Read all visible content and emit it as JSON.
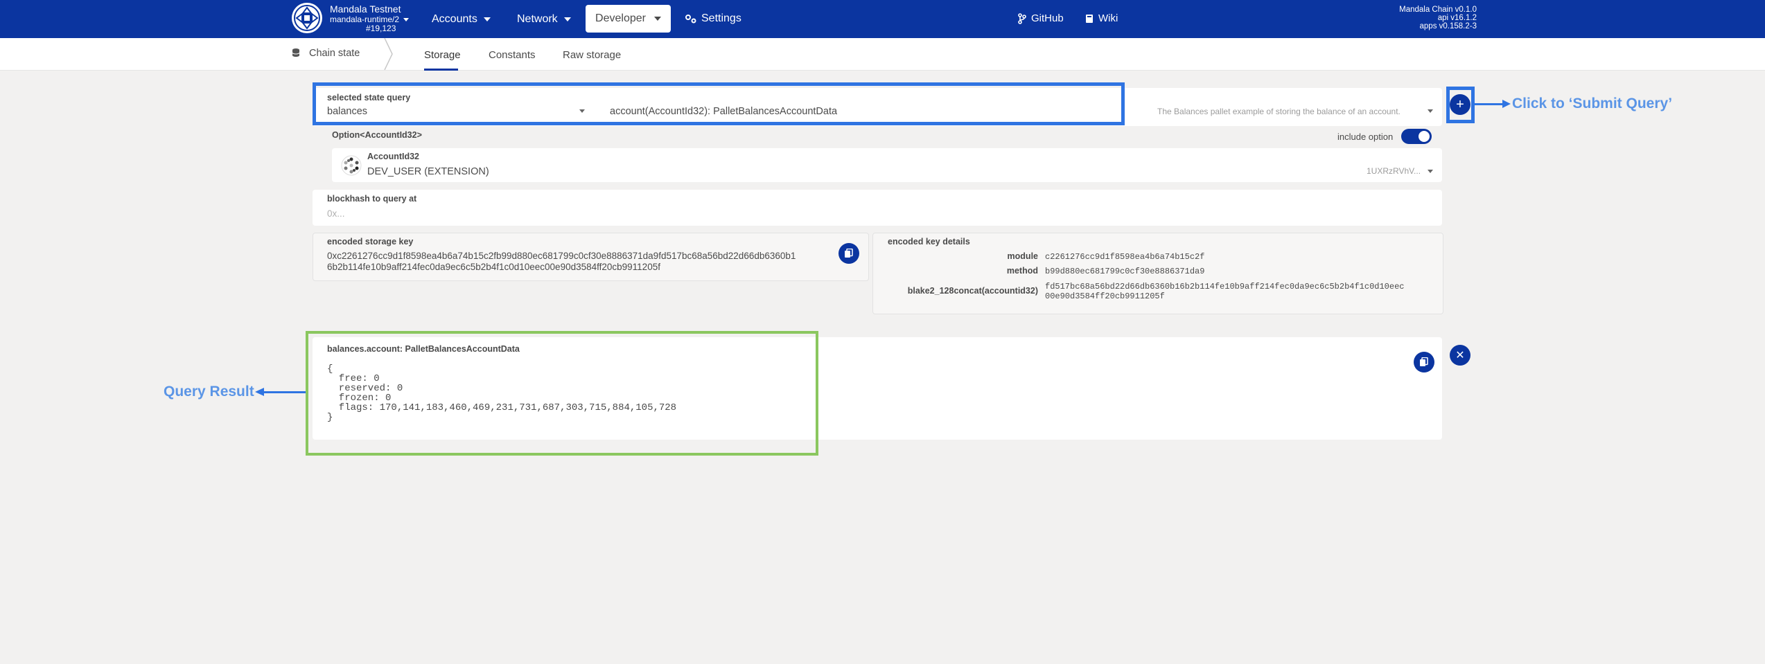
{
  "header": {
    "chain_name": "Mandala Testnet",
    "runtime": "mandala-runtime/2",
    "block": "#19,123",
    "nav": [
      "Accounts",
      "Network",
      "Developer",
      "Settings"
    ],
    "links": [
      "GitHub",
      "Wiki"
    ],
    "versions": [
      "Mandala Chain v0.1.0",
      "api v16.1.2",
      "apps v0.158.2-3"
    ]
  },
  "subnav": {
    "section": "Chain state",
    "tabs": [
      "Storage",
      "Constants",
      "Raw storage"
    ]
  },
  "query": {
    "label": "selected state query",
    "pallet": "balances",
    "method": "account(AccountId32): PalletBalancesAccountData",
    "description": "The Balances pallet example of storing the balance of an account."
  },
  "param": {
    "type_label": "Option<AccountId32>",
    "include_option": "include option",
    "account_label": "AccountId32",
    "account_name": "DEV_USER (EXTENSION)",
    "account_short": "1UXRzRVhV..."
  },
  "blockhash": {
    "label": "blockhash to query at",
    "placeholder": "0x..."
  },
  "storage_key": {
    "label": "encoded storage key",
    "line1": "0xc2261276cc9d1f8598ea4b6a74b15c2fb99d880ec681799c0cf30e8886371da9fd517bc68a56bd22d66db6360b1",
    "line2": "6b2b114fe10b9aff214fec0da9ec6c5b2b4f1c0d10eec00e90d3584ff20cb9911205f"
  },
  "key_details": {
    "label": "encoded key details",
    "rows": [
      {
        "key": "module",
        "value": "c2261276cc9d1f8598ea4b6a74b15c2f"
      },
      {
        "key": "method",
        "value": "b99d880ec681799c0cf30e8886371da9"
      },
      {
        "key": "blake2_128concat(accountid32)",
        "value": "fd517bc68a56bd22d66db6360b16b2b114fe10b9aff214fec0da9ec6c5b2b4f1c0d10eec",
        "value2": "00e90d3584ff20cb9911205f"
      }
    ]
  },
  "result": {
    "label": "balances.account: PalletBalancesAccountData",
    "body": "{\n  free: 0\n  reserved: 0\n  frozen: 0\n  flags: 170,141,183,460,469,231,731,687,303,715,884,105,728\n}"
  },
  "annotations": {
    "submit": "Click to ‘Submit Query’",
    "result": "Query Result"
  },
  "colors": {
    "brand": "#0b35a0",
    "highlight_blue": "#2f74e2",
    "highlight_green": "#8bc75f"
  }
}
